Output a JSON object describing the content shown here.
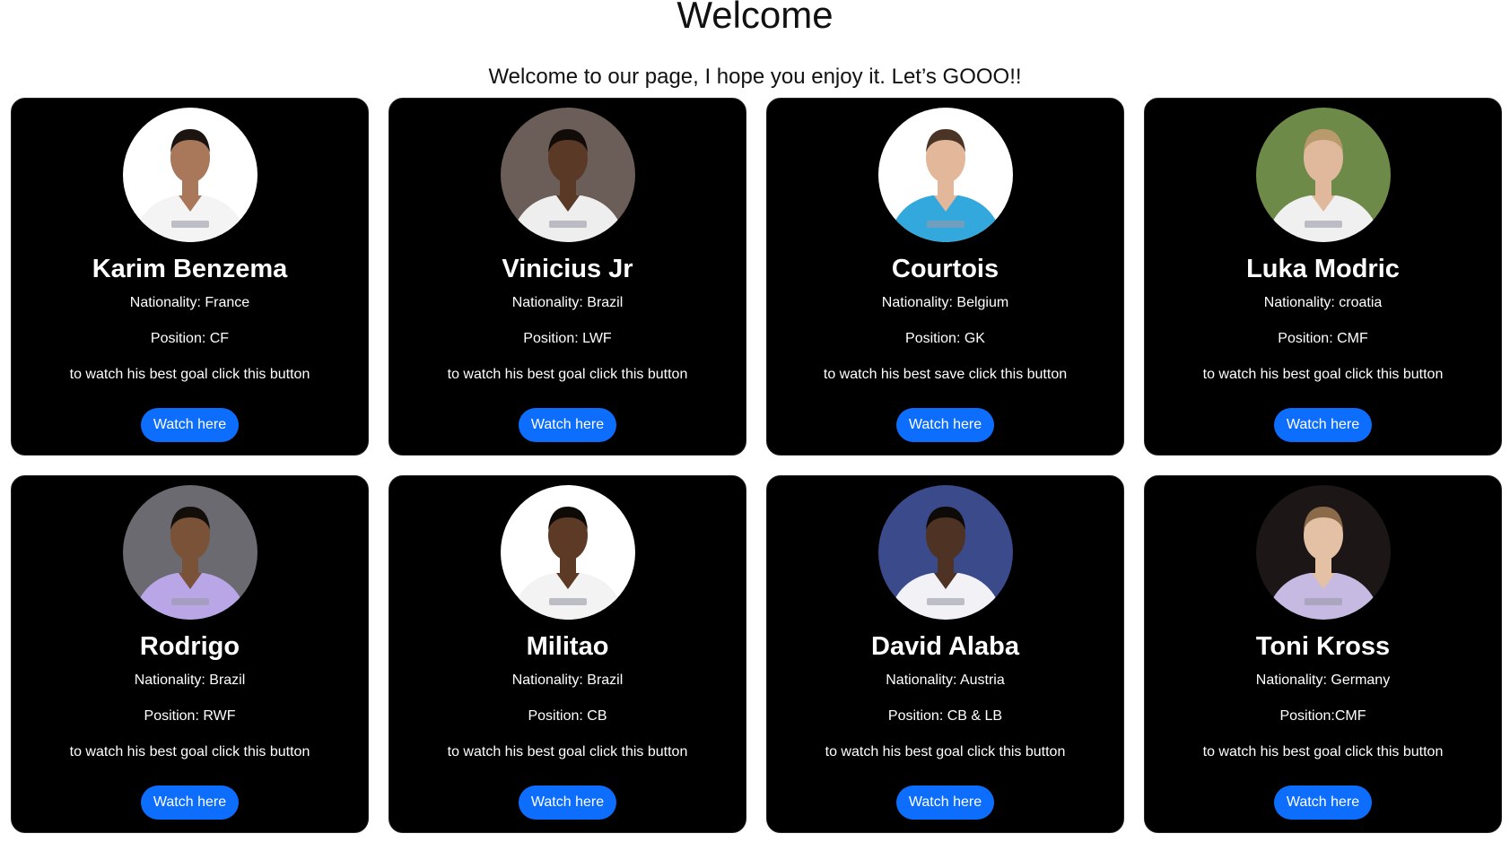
{
  "header": {
    "title": "Welcome",
    "subtitle": "Welcome to our page, I hope you enjoy it. Let’s GOOO!!"
  },
  "players": [
    {
      "name": "Karim Benzema",
      "nationality": "Nationality: France",
      "position": "Position: CF",
      "cta": "to watch his best goal click this button",
      "button": "Watch here",
      "bg": "#ffffff",
      "shirt": "#f4f4f4",
      "skin": "#a9785a",
      "hair": "#1b1410"
    },
    {
      "name": "Vinicius Jr",
      "nationality": "Nationality: Brazil",
      "position": "Position: LWF",
      "cta": "to watch his best goal click this button",
      "button": "Watch here",
      "bg": "#6b5d58",
      "shirt": "#eeeeee",
      "skin": "#5a3a26",
      "hair": "#120c08"
    },
    {
      "name": "Courtois",
      "nationality": "Nationality: Belgium",
      "position": "Position: GK",
      "cta": "to watch his best save click this button",
      "button": "Watch here",
      "bg": "#ffffff",
      "shirt": "#33a8dc",
      "skin": "#e2b79a",
      "hair": "#4a3426"
    },
    {
      "name": "Luka Modric",
      "nationality": "Nationality: croatia",
      "position": "Position: CMF",
      "cta": "to watch his best goal click this button",
      "button": "Watch here",
      "bg": "#6e8a48",
      "shirt": "#f0f0f0",
      "skin": "#e0b89c",
      "hair": "#b99a6c"
    },
    {
      "name": "Rodrigo",
      "nationality": "Nationality: Brazil",
      "position": "Position: RWF",
      "cta": "to watch his best goal click this button",
      "button": "Watch here",
      "bg": "#6a6a70",
      "shirt": "#b9a6e6",
      "skin": "#7a5238",
      "hair": "#140e0a"
    },
    {
      "name": "Militao",
      "nationality": "Nationality: Brazil",
      "position": "Position: CB",
      "cta": "to watch his best goal click this button",
      "button": "Watch here",
      "bg": "#ffffff",
      "shirt": "#f3f3f3",
      "skin": "#5c3a26",
      "hair": "#0e0a08"
    },
    {
      "name": "David Alaba",
      "nationality": "Nationality: Austria",
      "position": "Position: CB & LB",
      "cta": "to watch his best goal click this button",
      "button": "Watch here",
      "bg": "#3a4a8a",
      "shirt": "#f2f2f6",
      "skin": "#4e3224",
      "hair": "#0e0a08"
    },
    {
      "name": "Toni Kross",
      "nationality": "Nationality: Germany",
      "position": "Position:CMF",
      "cta": "to watch his best goal click this button",
      "button": "Watch here",
      "bg": "#1c1616",
      "shirt": "#c6b9e2",
      "skin": "#e4c0a4",
      "hair": "#8a6a48"
    }
  ]
}
